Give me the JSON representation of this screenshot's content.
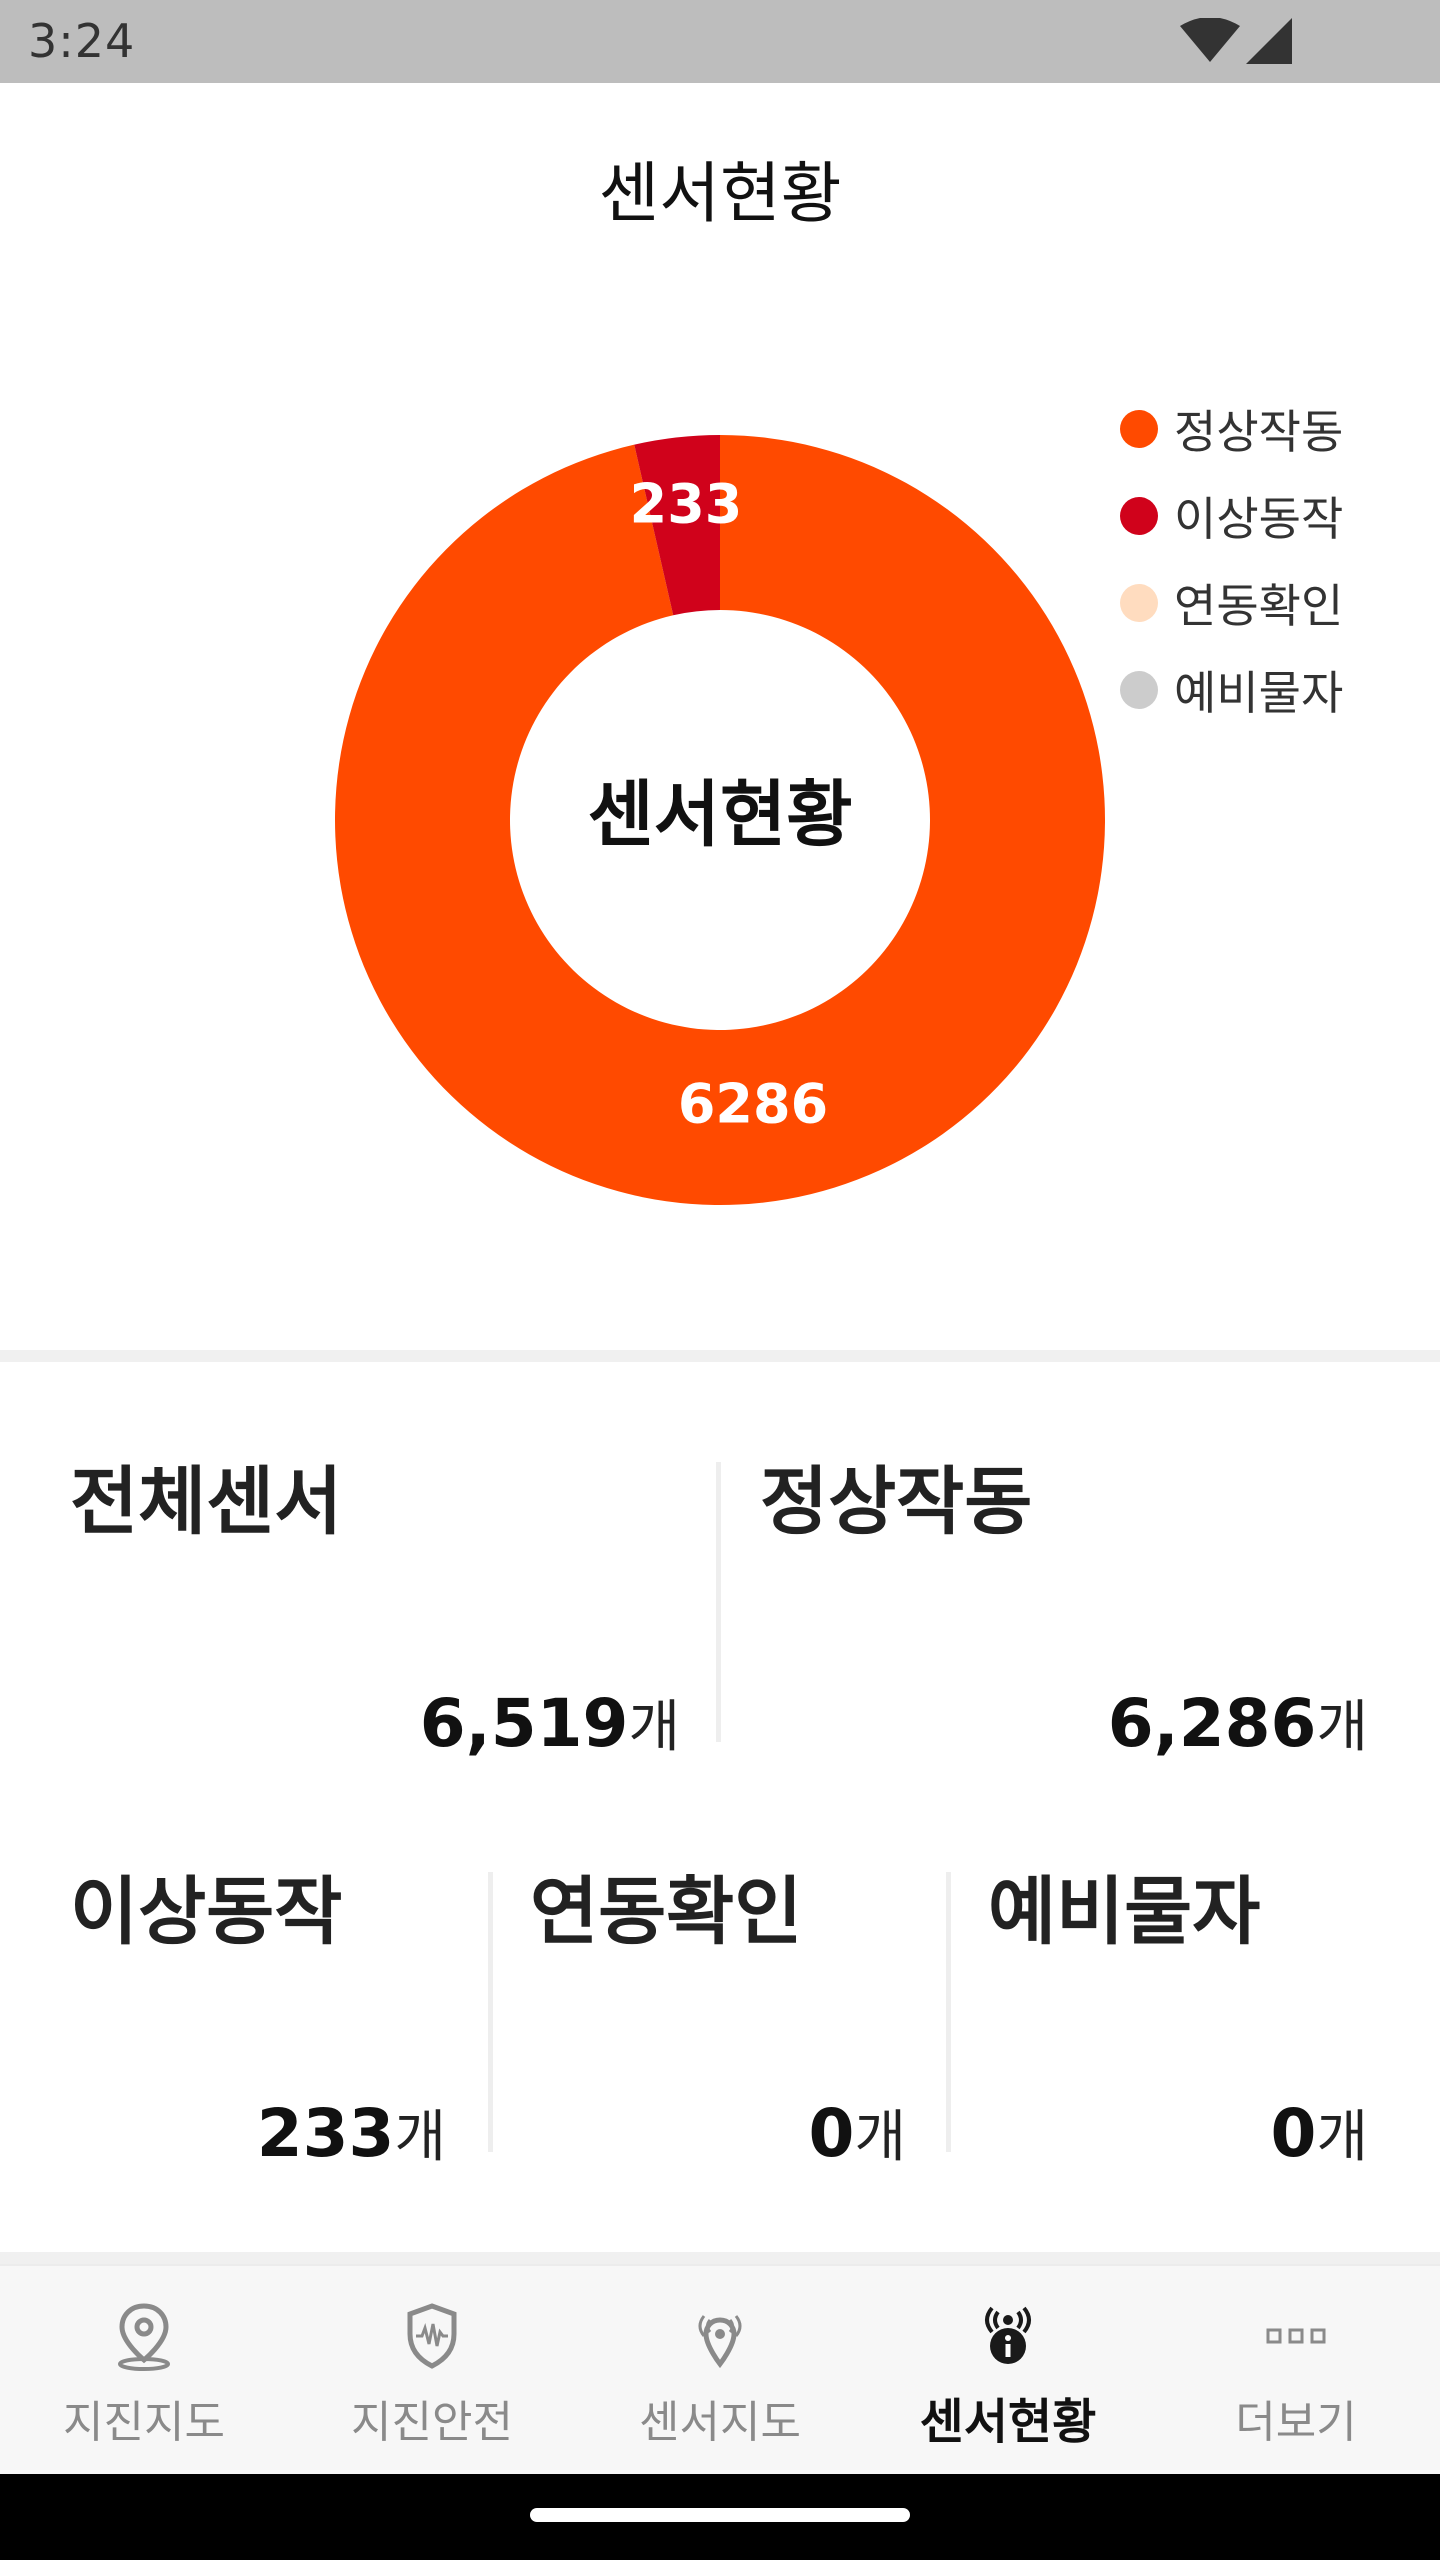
{
  "status_bar": {
    "time": "3:24"
  },
  "header": {
    "title": "센서현황"
  },
  "chart_data": {
    "type": "pie",
    "donut": true,
    "center_label": "센서현황",
    "categories": [
      "정상작동",
      "이상동작",
      "연동확인",
      "예비물자"
    ],
    "values": [
      6286,
      233,
      0,
      0
    ],
    "colors": [
      "#ff4a00",
      "#d0021b",
      "#ffdcbf",
      "#cccccc"
    ],
    "data_labels": [
      "6286",
      "233"
    ],
    "legend_position": "top-right"
  },
  "stats": {
    "total": {
      "title": "전체센서",
      "value": "6,519",
      "unit": "개"
    },
    "normal": {
      "title": "정상작동",
      "value": "6,286",
      "unit": "개"
    },
    "abnormal": {
      "title": "이상동작",
      "value": "233",
      "unit": "개"
    },
    "linked": {
      "title": "연동확인",
      "value": "0",
      "unit": "개"
    },
    "spare": {
      "title": "예비물자",
      "value": "0",
      "unit": "개"
    }
  },
  "nav": {
    "items": [
      {
        "label": "지진지도",
        "icon": "map-pin-icon"
      },
      {
        "label": "지진안전",
        "icon": "shield-wave-icon"
      },
      {
        "label": "센서지도",
        "icon": "sensor-pin-icon"
      },
      {
        "label": "센서현황",
        "icon": "sensor-info-icon",
        "active": true
      },
      {
        "label": "더보기",
        "icon": "more-icon"
      }
    ]
  }
}
